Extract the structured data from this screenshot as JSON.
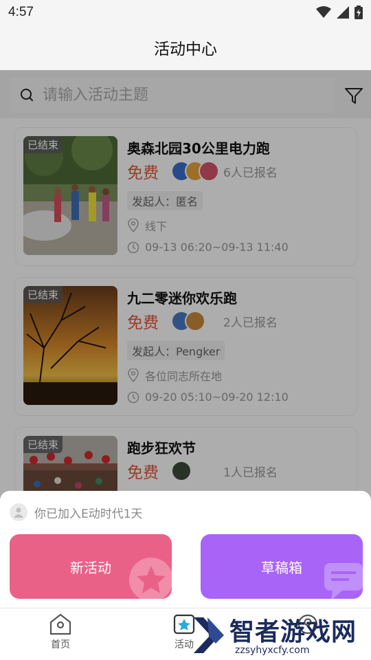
{
  "status_bar": {
    "time": "4:57"
  },
  "header": {
    "title": "活动中心"
  },
  "search": {
    "placeholder": "请输入活动主题"
  },
  "events": [
    {
      "badge": "已结束",
      "title": "奥森北园30公里电力跑",
      "price": "免费",
      "signup": "6人已报名",
      "organizer": "发起人：匿名",
      "location": "线下",
      "time": "09-13 06:20~09-13 11:40"
    },
    {
      "badge": "已结束",
      "title": "九二零迷你欢乐跑",
      "price": "免费",
      "signup": "2人已报名",
      "organizer": "发起人：Pengker",
      "location": "各位同志所在地",
      "time": "09-20 05:10~09-20 12:10"
    },
    {
      "badge": "已结束",
      "title": "跑步狂欢节",
      "price": "免费",
      "signup": "1人已报名"
    }
  ],
  "sheet": {
    "member_text": "你已加入E动时代1天",
    "new_activity_label": "新活动",
    "drafts_label": "草稿箱"
  },
  "tabbar": {
    "home_label": "首页",
    "activity_label": "活动"
  },
  "watermark": {
    "text": "智者游戏网",
    "url": "zzsyhyxcfy.com"
  },
  "colors": {
    "price": "#e0573a",
    "new_button": "#ea6188",
    "drafts_button": "#a864f6"
  }
}
